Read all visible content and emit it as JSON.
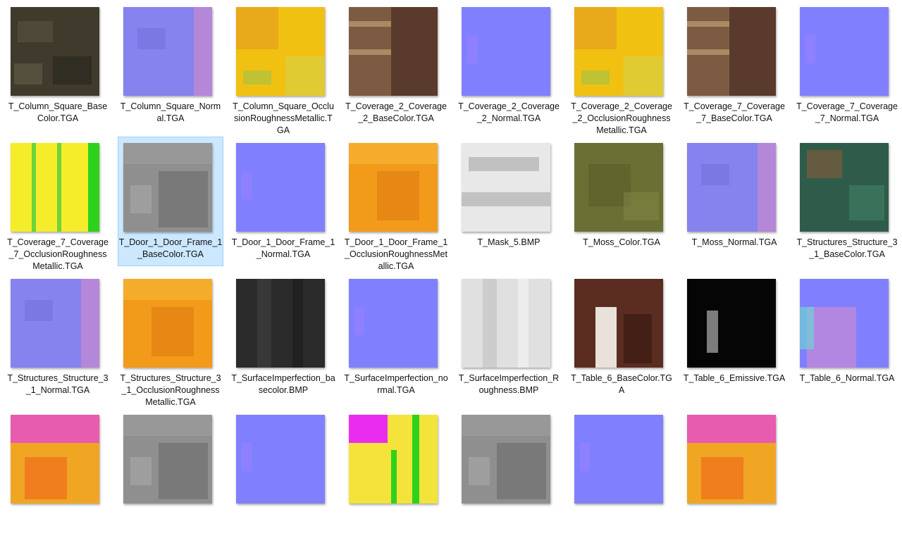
{
  "files": [
    {
      "name": "T_Column_Square_BaseColor.TGA",
      "kind": "dark-stone"
    },
    {
      "name": "T_Column_Square_Normal.TGA",
      "kind": "normal-detail"
    },
    {
      "name": "T_Column_Square_OcclusionRoughnessMetallic.TGA",
      "kind": "orm-yellow"
    },
    {
      "name": "T_Coverage_2_Coverage_2_BaseColor.TGA",
      "kind": "brown-wood"
    },
    {
      "name": "T_Coverage_2_Coverage_2_Normal.TGA",
      "kind": "normal-flat"
    },
    {
      "name": "T_Coverage_2_Coverage_2_OcclusionRoughnessMetallic.TGA",
      "kind": "orm-yellow"
    },
    {
      "name": "T_Coverage_7_Coverage_7_BaseColor.TGA",
      "kind": "brown-wood"
    },
    {
      "name": "T_Coverage_7_Coverage_7_Normal.TGA",
      "kind": "normal-flat"
    },
    {
      "name": "T_Coverage_7_Coverage_7_OcclusionRoughnessMetallic.TGA",
      "kind": "orm-green"
    },
    {
      "name": "T_Door_1_Door_Frame_1_BaseColor.TGA",
      "kind": "gray-panels",
      "selected": true
    },
    {
      "name": "T_Door_1_Door_Frame_1_Normal.TGA",
      "kind": "normal-flat"
    },
    {
      "name": "T_Door_1_Door_Frame_1_OcclusionRoughnessMetallic.TGA",
      "kind": "orm-orange"
    },
    {
      "name": "T_Mask_5.BMP",
      "kind": "mask-white"
    },
    {
      "name": "T_Moss_Color.TGA",
      "kind": "moss"
    },
    {
      "name": "T_Moss_Normal.TGA",
      "kind": "normal-detail"
    },
    {
      "name": "T_Structures_Structure_3_1_BaseColor.TGA",
      "kind": "teal-hex"
    },
    {
      "name": "T_Structures_Structure_3_1_Normal.TGA",
      "kind": "normal-detail"
    },
    {
      "name": "T_Structures_Structure_3_1_OcclusionRoughnessMetallic.TGA",
      "kind": "orm-orange"
    },
    {
      "name": "T_SurfaceImperfection_basecolor.BMP",
      "kind": "dark-gray"
    },
    {
      "name": "T_SurfaceImperfection_normal.TGA",
      "kind": "normal-flat"
    },
    {
      "name": "T_SurfaceImperfection_Roughness.BMP",
      "kind": "light-gray"
    },
    {
      "name": "T_Table_6_BaseColor.TGA",
      "kind": "table-rust"
    },
    {
      "name": "T_Table_6_Emissive.TGA",
      "kind": "black-emissive"
    },
    {
      "name": "T_Table_6_Normal.TGA",
      "kind": "normal-pink"
    },
    {
      "name": "",
      "kind": "orm-magenta"
    },
    {
      "name": "",
      "kind": "gray-panels"
    },
    {
      "name": "",
      "kind": "normal-flat"
    },
    {
      "name": "",
      "kind": "orm-green-magenta"
    },
    {
      "name": "",
      "kind": "gray-panels"
    },
    {
      "name": "",
      "kind": "normal-flat"
    },
    {
      "name": "",
      "kind": "orm-magenta"
    }
  ],
  "colors": {
    "selection_bg": "#cce8ff",
    "selection_border": "#99d1ff",
    "normal_blue": "#8080ff"
  }
}
